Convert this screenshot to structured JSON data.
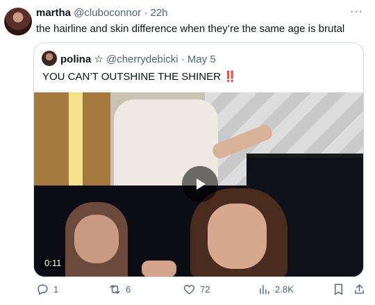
{
  "tweet": {
    "name": "martha",
    "handle": "@cluboconnor",
    "separator": "·",
    "time": "22h",
    "text": "the hairline and skin difference when they’re the same age is brutal",
    "more": "···"
  },
  "quote": {
    "name": "polina",
    "badge": "☆",
    "handle": "@cherrydebicki",
    "separator": "·",
    "date": "May 5",
    "text": "YOU CAN’T OUTSHINE THE SHINER",
    "emphasis": "‼️",
    "video": {
      "duration": "0:11"
    }
  },
  "actions": {
    "replies": "1",
    "retweets": "6",
    "likes": "72",
    "views": "2.8K"
  }
}
